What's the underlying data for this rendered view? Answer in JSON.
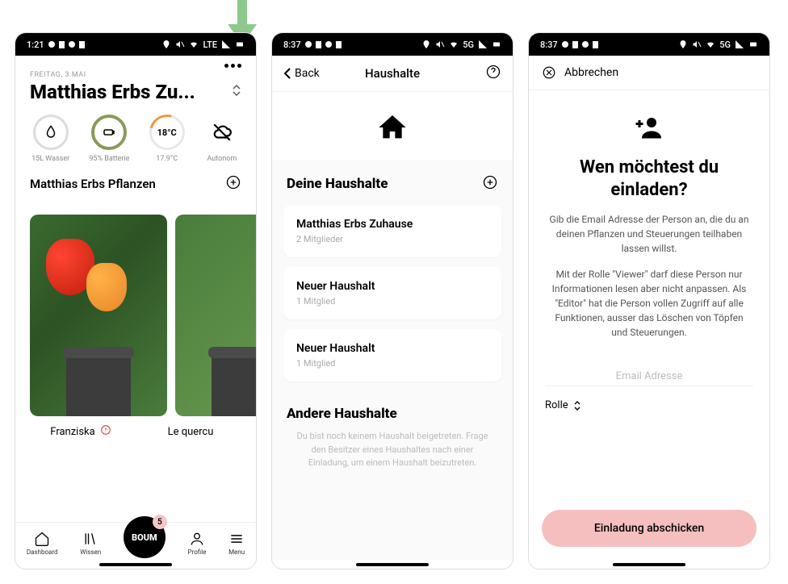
{
  "screen1": {
    "status": {
      "time": "1:21",
      "network": "LTE"
    },
    "date": "FREITAG, 3.MAI",
    "household_title": "Matthias Erbs Zu...",
    "metrics": {
      "water": {
        "value": "15L Wasser"
      },
      "battery": {
        "value": "95% Batterie"
      },
      "temp": {
        "ring_value": "18°C",
        "value": "17.9°C"
      },
      "mode": {
        "value": "Autonom"
      }
    },
    "plants_header": "Matthias Erbs Pflanzen",
    "plants": [
      {
        "name": "Franziska"
      },
      {
        "name": "Le quercu"
      }
    ],
    "nav": {
      "dashboard": "Dashboard",
      "wissen": "Wissen",
      "boum": "BOUM",
      "boum_badge": "5",
      "profile": "Profile",
      "menu": "Menu"
    }
  },
  "screen2": {
    "status": {
      "time": "8:37",
      "network": "5G"
    },
    "appbar": {
      "back": "Back",
      "title": "Haushalte"
    },
    "section_your": "Deine Haushalte",
    "households": [
      {
        "name": "Matthias Erbs Zuhause",
        "members": "2 Mitglieder"
      },
      {
        "name": "Neuer Haushalt",
        "members": "1 Mitglied"
      },
      {
        "name": "Neuer Haushalt",
        "members": "1 Mitglied"
      }
    ],
    "section_other": "Andere Haushalte",
    "empty_text": "Du bist noch keinem Haushalt beigetreten.\nFrage den Besitzer eines Haushaltes nach einer Einladung, um einem Haushalt beizutreten."
  },
  "screen3": {
    "status": {
      "time": "8:37",
      "network": "5G"
    },
    "cancel": "Abbrechen",
    "heading": "Wen möchtest du einladen?",
    "paragraph1": "Gib die Email Adresse der Person an, die du an deinen Pflanzen und Steuerungen teilhaben lassen willst.",
    "paragraph2": "Mit der Rolle \"Viewer\" darf diese Person nur Informationen lesen aber nicht anpassen. Als \"Editor\" hat die Person vollen Zugriff auf alle Funktionen, ausser das Löschen von Töpfen und Steuerungen.",
    "email_placeholder": "Email Adresse",
    "role_label": "Rolle",
    "send_button": "Einladung abschicken"
  }
}
